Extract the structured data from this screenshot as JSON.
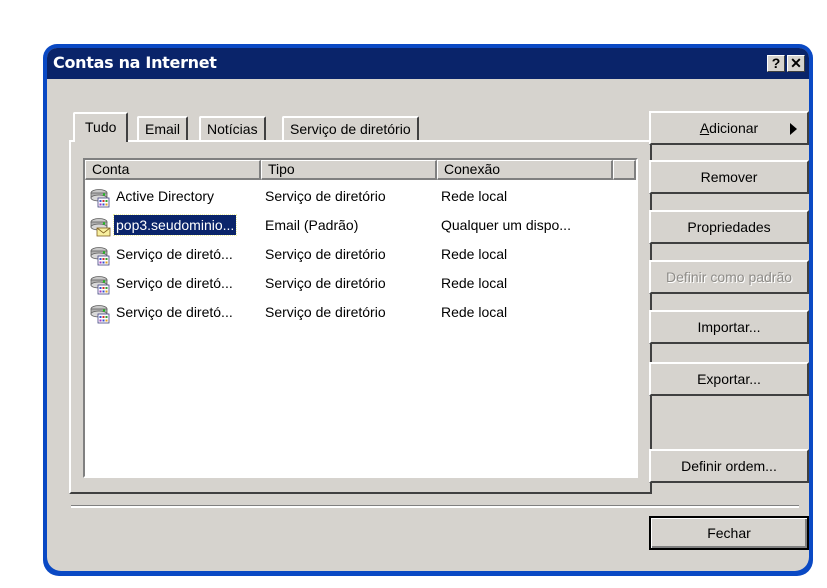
{
  "window": {
    "title": "Contas na Internet",
    "help_button": "?",
    "close_button": "✕"
  },
  "tabs": [
    {
      "label": "Tudo",
      "active": true
    },
    {
      "label": "Email",
      "active": false
    },
    {
      "label": "Notícias",
      "active": false
    },
    {
      "label": "Serviço de diretório",
      "active": false
    }
  ],
  "list": {
    "columns": [
      "Conta",
      "Tipo",
      "Conexão"
    ],
    "rows": [
      {
        "conta": "Active Directory",
        "tipo": "Serviço de diretório",
        "conexao": "Rede local",
        "icon": "directory-service-icon",
        "selected": false
      },
      {
        "conta": "pop3.seudominio...",
        "tipo": "Email (Padrão)",
        "conexao": "Qualquer um dispo...",
        "icon": "mail-account-icon",
        "selected": true
      },
      {
        "conta": "Serviço de diretó...",
        "tipo": "Serviço de diretório",
        "conexao": "Rede local",
        "icon": "directory-service-icon",
        "selected": false
      },
      {
        "conta": "Serviço de diretó...",
        "tipo": "Serviço de diretório",
        "conexao": "Rede local",
        "icon": "directory-service-icon",
        "selected": false
      },
      {
        "conta": "Serviço de diretó...",
        "tipo": "Serviço de diretório",
        "conexao": "Rede local",
        "icon": "directory-service-icon",
        "selected": false
      }
    ]
  },
  "buttons": {
    "adicionar_accel": "A",
    "adicionar_rest": "dicionar",
    "remover": "Remover",
    "propriedades": "Propriedades",
    "definir_padrao": "Definir como padrão",
    "importar": "Importar...",
    "exportar": "Exportar...",
    "definir_ordem": "Definir ordem...",
    "fechar": "Fechar"
  },
  "colors": {
    "titlebar": "#0a246a",
    "frame": "#0a49c4",
    "face": "#d6d3ce",
    "selection": "#0a246a"
  }
}
